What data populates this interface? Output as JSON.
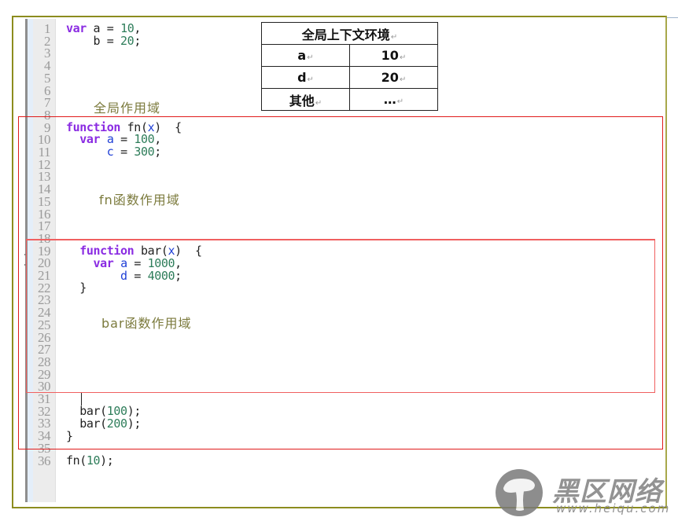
{
  "editor": {
    "line_numbers": [
      "1",
      "2",
      "3",
      "4",
      "5",
      "6",
      "7",
      "8",
      "9",
      "10",
      "11",
      "12",
      "13",
      "14",
      "15",
      "16",
      "17",
      "18",
      "19",
      "20",
      "21",
      "22",
      "23",
      "24",
      "25",
      "26",
      "27",
      "28",
      "29",
      "30",
      "31",
      "32",
      "33",
      "34",
      "35",
      "36"
    ],
    "code": {
      "l1": {
        "kw": "var",
        "rest1": " a = ",
        "num": "10",
        "rest2": ","
      },
      "l2": {
        "rest1": "    b = ",
        "num": "20",
        "rest2": ";"
      },
      "l9": {
        "kw": "function",
        "rest1": " fn(",
        "var": "x",
        "rest2": ")  {"
      },
      "l10": {
        "indent": "  ",
        "kw": "var",
        "sp": " ",
        "var": "a",
        "rest1": " = ",
        "num": "100",
        "rest2": ","
      },
      "l11": {
        "indent": "      ",
        "var": "c",
        "rest1": " = ",
        "num": "300",
        "rest2": ";"
      },
      "l19": {
        "indent": "  ",
        "kw": "function",
        "rest1": " bar(",
        "var": "x",
        "rest2": ")  {"
      },
      "l20": {
        "indent": "    ",
        "kw": "var",
        "sp": " ",
        "var": "a",
        "rest1": " = ",
        "num": "1000",
        "rest2": ","
      },
      "l21": {
        "indent": "        ",
        "var": "d",
        "rest1": " = ",
        "num": "4000",
        "rest2": ";"
      },
      "l22": {
        "text": "  }"
      },
      "l32": {
        "rest1": "  bar(",
        "num": "100",
        "rest2": ");"
      },
      "l33": {
        "rest1": "  bar(",
        "num": "200",
        "rest2": ");"
      },
      "l34": {
        "text": "}"
      },
      "l36": {
        "rest1": "fn(",
        "num": "10",
        "rest2": ");"
      }
    }
  },
  "scopes": {
    "global": "全局作用域",
    "fn": "fn函数作用域",
    "bar": "bar函数作用域"
  },
  "context_table": {
    "title": "全局上下文环境",
    "rows": [
      {
        "key": "a",
        "value": "10"
      },
      {
        "key": "d",
        "value": "20"
      },
      {
        "key": "其他",
        "value": "…"
      }
    ],
    "return_mark": "↵"
  },
  "watermark": {
    "name": "黑区网络",
    "url": "www.heiqu.com"
  }
}
